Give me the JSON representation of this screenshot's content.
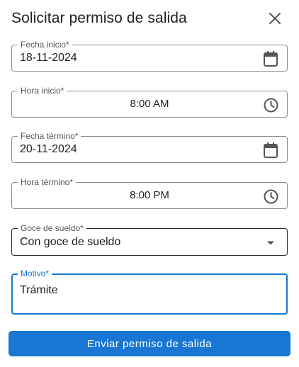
{
  "dialog": {
    "title": "Solicitar permiso de salida",
    "close_icon": "close-icon"
  },
  "fields": {
    "fecha_inicio": {
      "label": "Fecha inicio*",
      "value": "18-11-2024",
      "icon": "calendar-icon"
    },
    "hora_inicio": {
      "label": "Hora inicio*",
      "value": "8:00 AM",
      "icon": "clock-icon"
    },
    "fecha_termino": {
      "label": "Fecha término*",
      "value": "20-11-2024",
      "icon": "calendar-icon"
    },
    "hora_termino": {
      "label": "Hora término*",
      "value": "8:00 PM",
      "icon": "clock-icon"
    },
    "goce_sueldo": {
      "label": "Goce de sueldo*",
      "value": "Con goce de sueldo",
      "icon": "dropdown-arrow-icon"
    },
    "motivo": {
      "label": "Motivo*",
      "value": "Trámite"
    }
  },
  "submit": {
    "label": "Enviar permiso de salida"
  },
  "colors": {
    "primary": "#1976d2",
    "border": "#8c8c8c",
    "text": "#1f1f1f",
    "icon": "#555555"
  }
}
